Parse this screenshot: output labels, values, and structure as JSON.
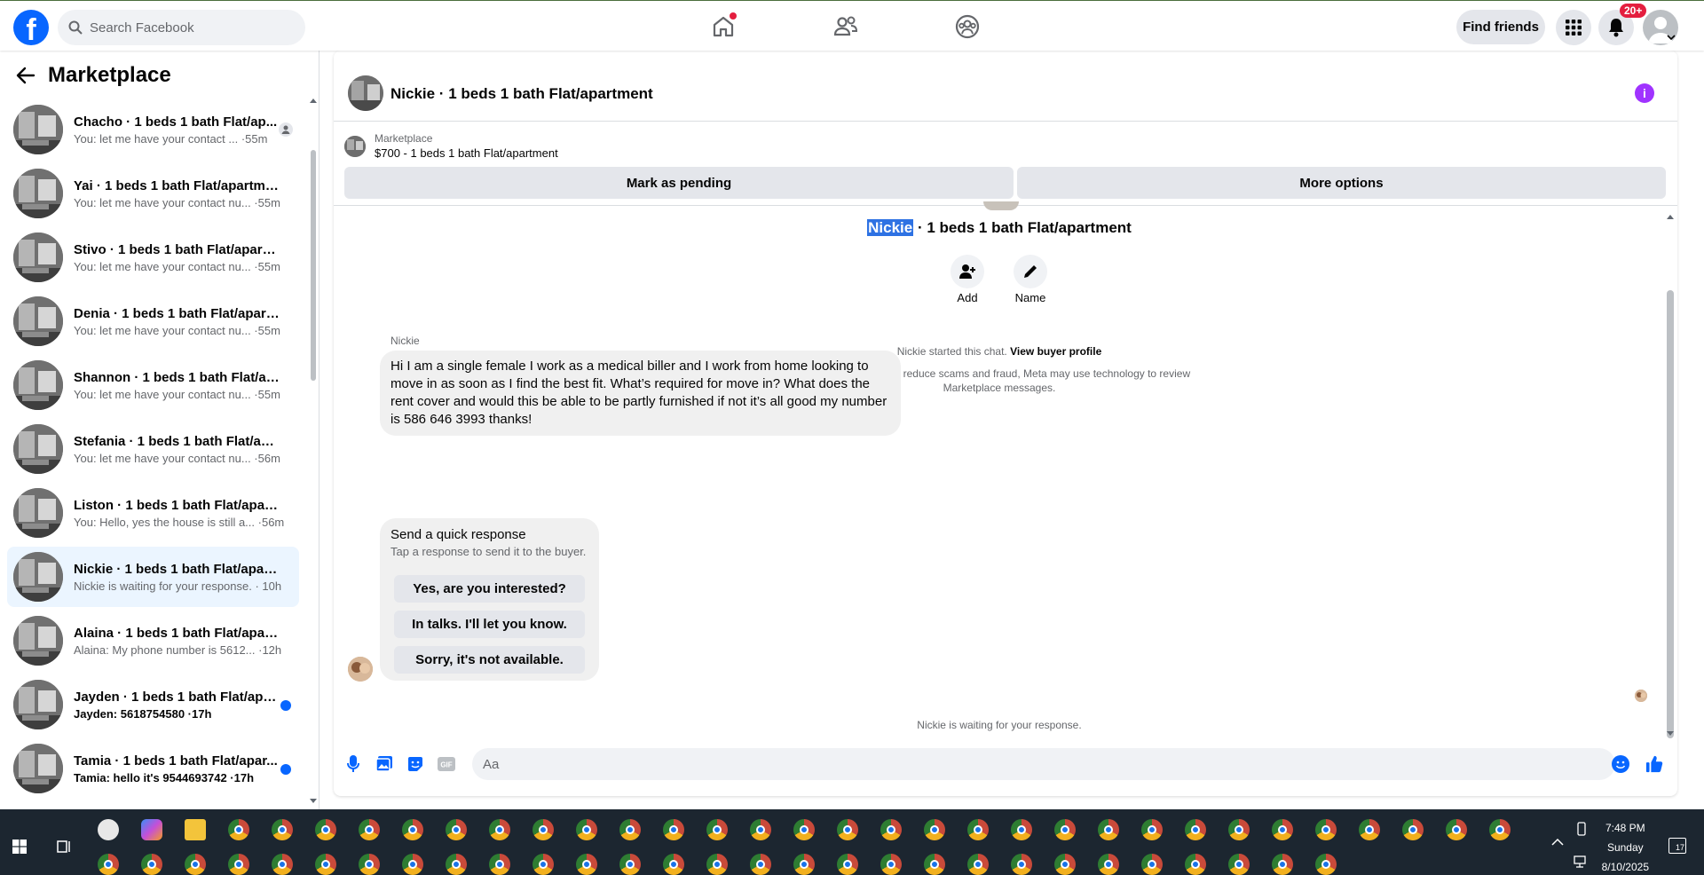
{
  "header": {
    "search_placeholder": "Search Facebook",
    "find_friends": "Find friends",
    "notif_count": "20+"
  },
  "sidebar": {
    "title": "Marketplace",
    "conversations": [
      {
        "name": "Chacho · 1 beds 1 bath Flat/ap...",
        "preview": "You: let me have your contact ... ·55m",
        "unread": false
      },
      {
        "name": "Yai · 1 beds 1 bath Flat/apartment",
        "preview": "You: let me have your contact nu... ·55m",
        "unread": false
      },
      {
        "name": "Stivo · 1 beds 1 bath Flat/apartm...",
        "preview": "You: let me have your contact nu... ·55m",
        "unread": false
      },
      {
        "name": "Denia · 1 beds 1 bath Flat/apart...",
        "preview": "You: let me have your contact nu... ·55m",
        "unread": false
      },
      {
        "name": "Shannon · 1 beds 1 bath Flat/apa...",
        "preview": "You: let me have your contact nu... ·55m",
        "unread": false
      },
      {
        "name": "Stefania · 1 beds 1 bath Flat/apar...",
        "preview": "You: let me have your contact nu... ·56m",
        "unread": false
      },
      {
        "name": "Liston · 1 beds 1 bath Flat/apart...",
        "preview": "You: Hello, yes the house is still a... ·56m",
        "unread": false
      },
      {
        "name": "Nickie · 1 beds 1 bath Flat/apart...",
        "preview": "Nickie is waiting for your response. · 10h",
        "unread": false
      },
      {
        "name": "Alaina · 1 beds 1 bath Flat/apart...",
        "preview": "Alaina: My phone number is 5612... ·12h",
        "unread": false
      },
      {
        "name": "Jayden · 1 beds 1 bath Flat/apa...",
        "preview": "Jayden: 5618754580 ·17h",
        "unread": true
      },
      {
        "name": "Tamia · 1 beds 1 bath Flat/apar...",
        "preview": "Tamia: hello it's 9544693742 ·17h",
        "unread": true
      }
    ]
  },
  "chat": {
    "header_title": "Nickie · 1 beds 1 bath Flat/apartment",
    "listing_source": "Marketplace",
    "listing_title": "$700 - 1 beds 1 bath Flat/apartment",
    "mark_pending": "Mark as pending",
    "more_options": "More options",
    "title_name": "Nickie",
    "title_rest": " · 1 beds 1 bath Flat/apartment",
    "add_label": "Add",
    "name_label": "Name",
    "started_text": "Nickie started this chat.",
    "view_profile": "View buyer profile",
    "scam_notice_1": "To help identify and reduce scams and fraud, Meta may use technology to review",
    "scam_notice_2": "Marketplace messages.",
    "sender": "Nickie",
    "message": "Hi I am a single female I work as a medical biller and I work from home looking to move in as soon as I find the best fit. What’s required for move in? What does the rent cover and would this be able to be partly furnished if not it’s all good my number is 586 646 3993 thanks!",
    "quick_title": "Send a quick response",
    "quick_sub": "Tap a response to send it to the buyer.",
    "quick_options": [
      "Yes, are you interested?",
      "In talks. I'll let you know.",
      "Sorry, it's not available."
    ],
    "waiting": "Nickie is waiting for your response.",
    "input_placeholder": "Aa"
  },
  "taskbar": {
    "time": "7:48 PM",
    "day": "Sunday",
    "date": "8/10/2025",
    "notif": "17"
  },
  "colors": {
    "accent": "#0866ff",
    "info": "#a033ff",
    "badge": "#e41e3f",
    "highlight": "#2e72e3"
  }
}
